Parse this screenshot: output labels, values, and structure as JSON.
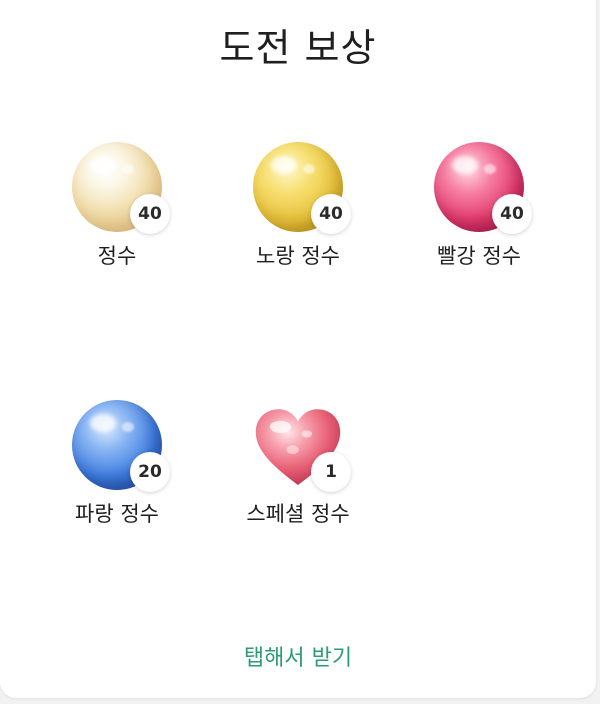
{
  "dialog": {
    "title": "도전 보상",
    "claim_label": "탭해서 받기"
  },
  "rewards": [
    {
      "label": "정수",
      "count": "40",
      "icon": "white-essence-orb-icon"
    },
    {
      "label": "노랑 정수",
      "count": "40",
      "icon": "yellow-essence-orb-icon"
    },
    {
      "label": "빨강 정수",
      "count": "40",
      "icon": "red-essence-orb-icon"
    },
    {
      "label": "파랑 정수",
      "count": "20",
      "icon": "blue-essence-orb-icon"
    },
    {
      "label": "스페셜 정수",
      "count": "1",
      "icon": "pink-heart-essence-icon"
    }
  ],
  "colors": {
    "claim_text": "#2e9b73",
    "title_text": "#1f1f1f"
  }
}
